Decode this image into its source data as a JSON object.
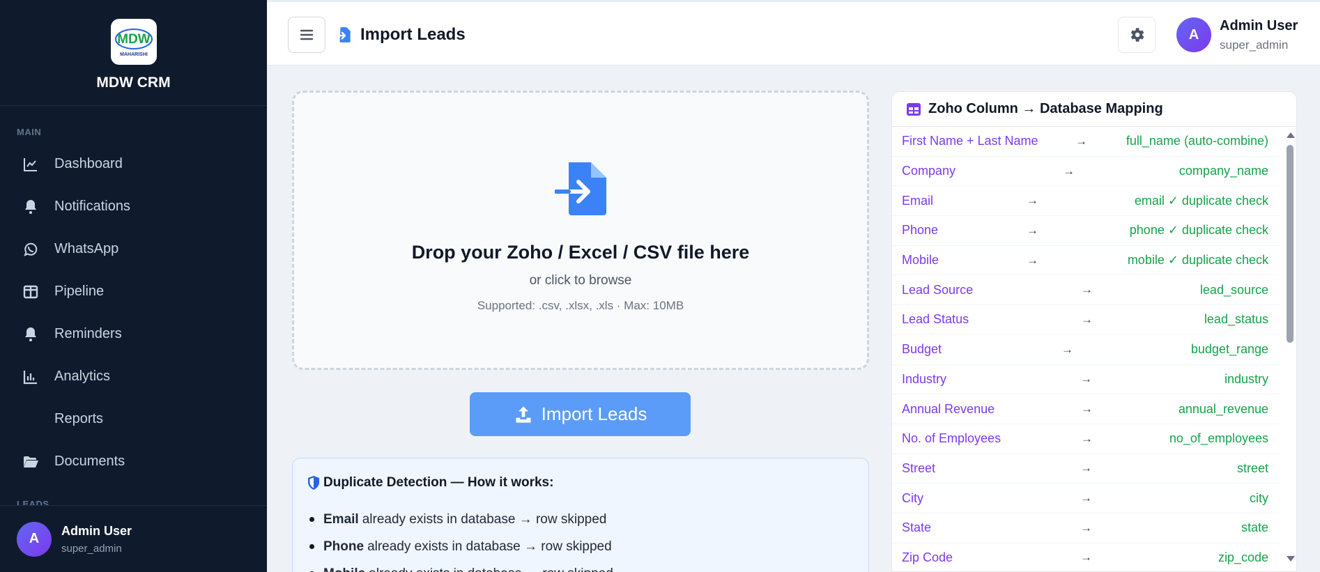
{
  "sidebar": {
    "brand_name": "MDW CRM",
    "logo_text": "MDW",
    "logo_subtext": "MAHARISHI",
    "section_main": "MAIN",
    "section_leads": "LEADS",
    "items": [
      {
        "label": "Dashboard",
        "icon": "chart-line-icon"
      },
      {
        "label": "Notifications",
        "icon": "bell-icon"
      },
      {
        "label": "WhatsApp",
        "icon": "whatsapp-icon"
      },
      {
        "label": "Pipeline",
        "icon": "columns-icon"
      },
      {
        "label": "Reminders",
        "icon": "bell-icon"
      },
      {
        "label": "Analytics",
        "icon": "bar-chart-icon"
      },
      {
        "label": "Reports",
        "icon": ""
      },
      {
        "label": "Documents",
        "icon": "folder-open-icon"
      }
    ],
    "user": {
      "initial": "A",
      "name": "Admin User",
      "role": "super_admin"
    }
  },
  "header": {
    "title": "Import Leads",
    "user": {
      "initial": "A",
      "name": "Admin User",
      "role": "super_admin"
    }
  },
  "dropzone": {
    "title": "Drop your Zoho / Excel / CSV file here",
    "subtitle": "or click to browse",
    "hint": "Supported: .csv, .xlsx, .xls  ·  Max: 10MB"
  },
  "import_button": {
    "label": "Import Leads"
  },
  "duplicate_info": {
    "title": "Duplicate Detection — How it works:",
    "items": [
      {
        "field": "Email",
        "text": "already exists in database → row skipped"
      },
      {
        "field": "Phone",
        "text": "already exists in database → row skipped"
      },
      {
        "field": "Mobile",
        "text": "already exists in database → row skipped"
      }
    ]
  },
  "mapping": {
    "title": "Zoho Column → Database Mapping",
    "arrow": "→",
    "rows": [
      {
        "src": "First Name + Last Name",
        "dst": "full_name (auto-combine)"
      },
      {
        "src": "Company",
        "dst": "company_name"
      },
      {
        "src": "Email",
        "dst": "email ✓ duplicate check"
      },
      {
        "src": "Phone",
        "dst": "phone ✓ duplicate check"
      },
      {
        "src": "Mobile",
        "dst": "mobile ✓ duplicate check"
      },
      {
        "src": "Lead Source",
        "dst": "lead_source"
      },
      {
        "src": "Lead Status",
        "dst": "lead_status"
      },
      {
        "src": "Budget",
        "dst": "budget_range"
      },
      {
        "src": "Industry",
        "dst": "industry"
      },
      {
        "src": "Annual Revenue",
        "dst": "annual_revenue"
      },
      {
        "src": "No. of Employees",
        "dst": "no_of_employees"
      },
      {
        "src": "Street",
        "dst": "street"
      },
      {
        "src": "City",
        "dst": "city"
      },
      {
        "src": "State",
        "dst": "state"
      },
      {
        "src": "Zip Code",
        "dst": "zip_code"
      }
    ]
  },
  "colors": {
    "sidebar_bg": "#0f1b2d",
    "accent_blue": "#5a9cf8",
    "source_purple": "#7c3aed",
    "target_green": "#16a34a"
  }
}
